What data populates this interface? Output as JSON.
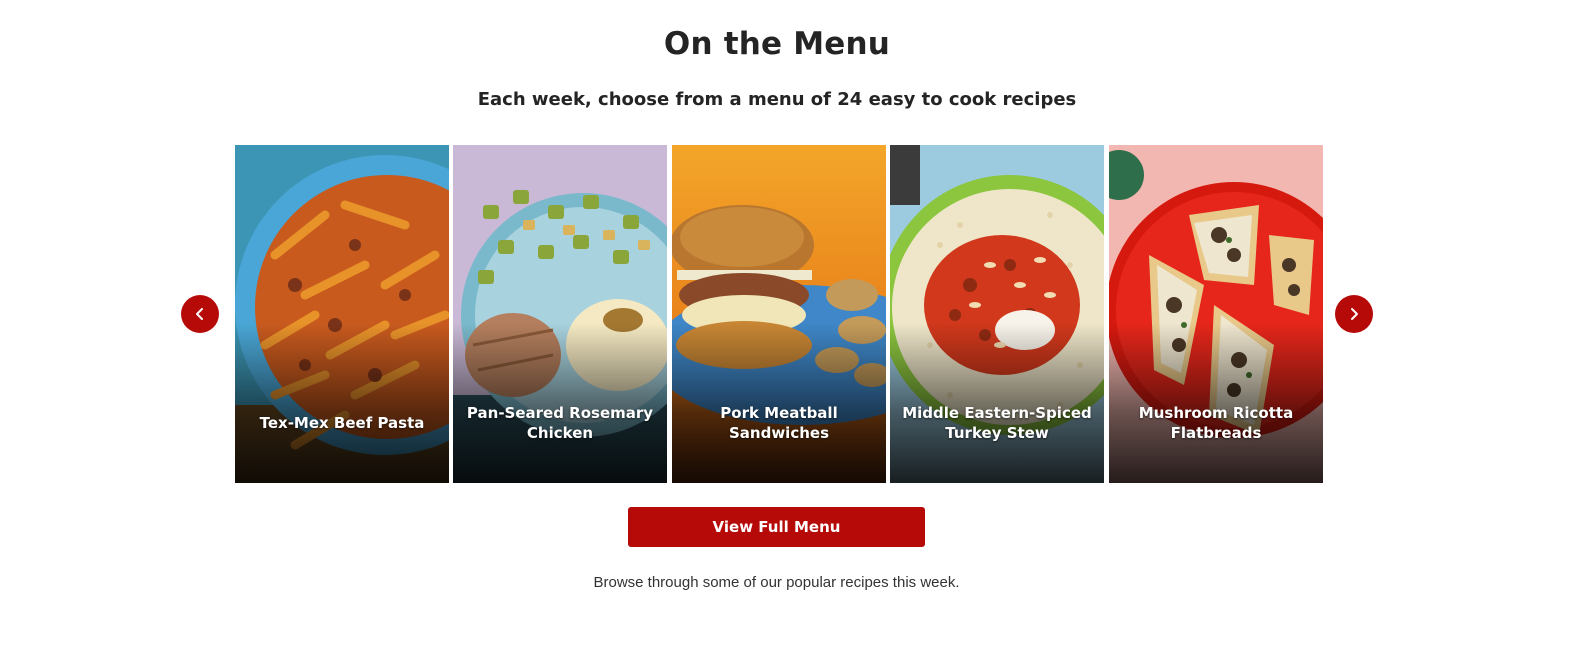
{
  "section": {
    "title": "On the Menu",
    "subtitle": "Each week, choose from a menu of 24 easy to cook recipes"
  },
  "recipes": [
    {
      "name": "Tex-Mex Beef Pasta"
    },
    {
      "name": "Pan-Seared Rosemary Chicken"
    },
    {
      "name": "Pork Meatball Sandwiches"
    },
    {
      "name": "Middle Eastern-Spiced Turkey Stew"
    },
    {
      "name": "Mushroom Ricotta Flatbreads"
    }
  ],
  "carousel": {
    "prev_icon": "chevron-left-icon",
    "next_icon": "chevron-right-icon"
  },
  "cta": {
    "label": "View Full Menu"
  },
  "footer_note": "Browse through some of our popular recipes this week.",
  "colors": {
    "accent": "#b50a08",
    "text": "#242424"
  }
}
